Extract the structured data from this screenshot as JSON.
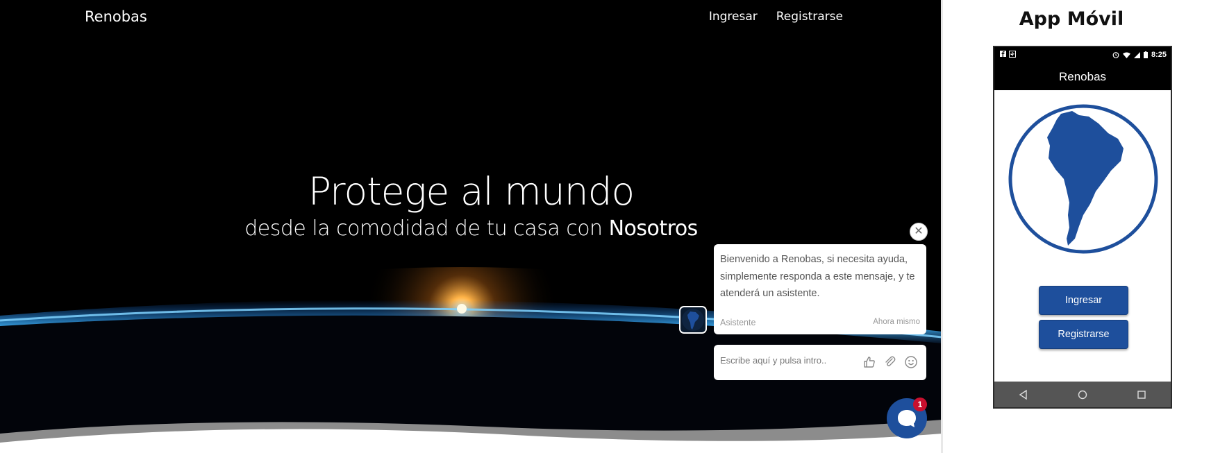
{
  "site": {
    "brand": "Renobas",
    "nav": {
      "login": "Ingresar",
      "register": "Registrarse"
    }
  },
  "hero": {
    "title": "Protege al mundo",
    "subtitle_prefix": "desde la comodidad de tu casa con",
    "subtitle_emphasis": "Nosotros"
  },
  "chat": {
    "message": "Bienvenido a Renobas, si necesita ayuda, simplemente responda a este mensaje, y te atenderá un asistente.",
    "sender": "Asistente",
    "time": "Ahora mismo",
    "input_placeholder": "Escribe aquí y pulsa intro..",
    "icons": [
      "thumbs-up-icon",
      "paperclip-icon",
      "emoji-icon"
    ],
    "unread_count": "1",
    "close_icon": "close-icon"
  },
  "app_preview": {
    "heading": "App Móvil",
    "status_time": "8:25",
    "app_title": "Renobas",
    "buttons": {
      "login": "Ingresar",
      "register": "Registrarse"
    },
    "nav_icons": [
      "back-icon",
      "home-icon",
      "recents-icon"
    ]
  },
  "colors": {
    "primary_blue": "#1e4f9c",
    "badge_red": "#c8102e",
    "hero_bg": "#000000"
  }
}
